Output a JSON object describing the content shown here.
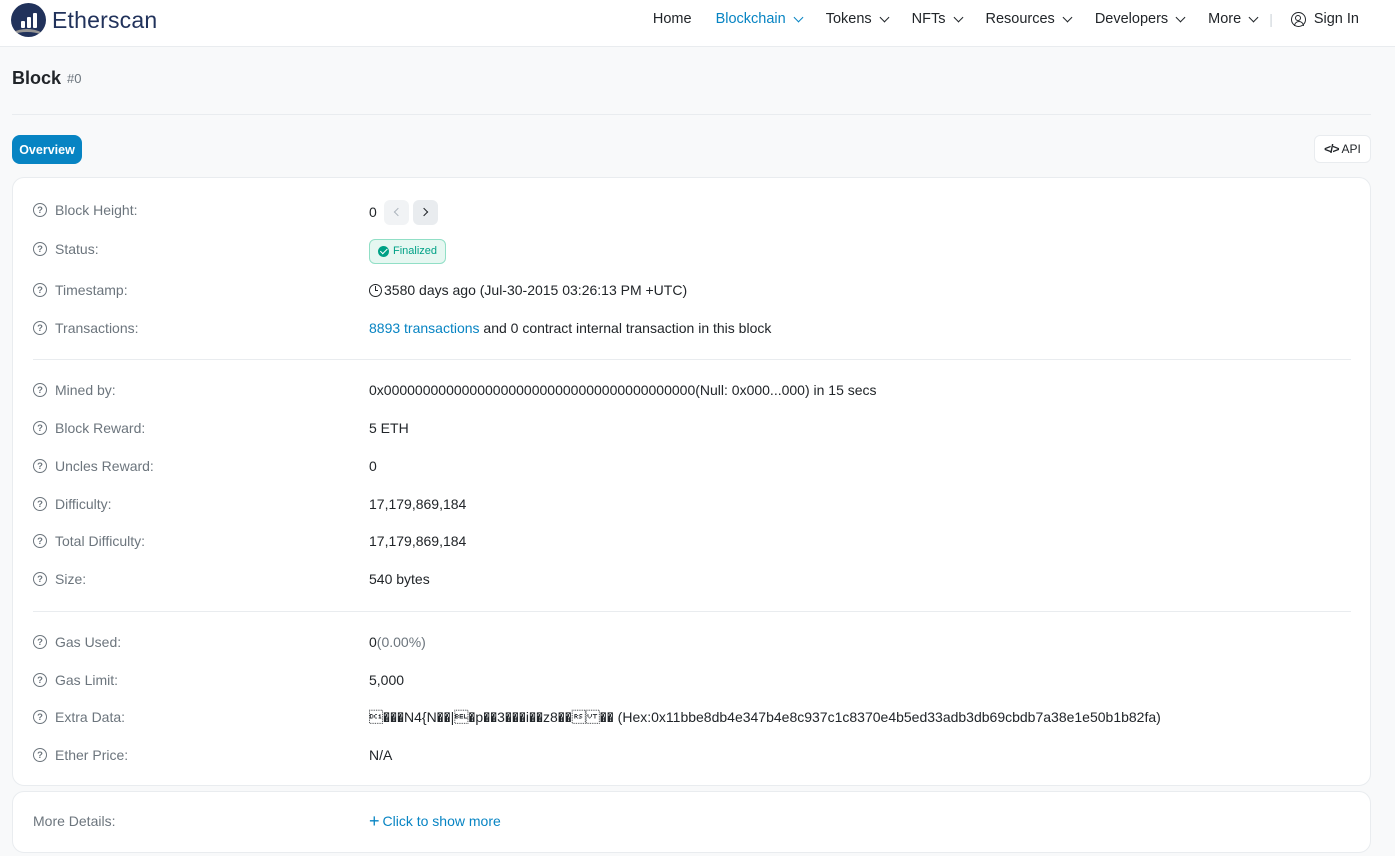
{
  "header": {
    "logo_text": "Etherscan",
    "nav": [
      {
        "label": "Home",
        "dropdown": false,
        "active": false
      },
      {
        "label": "Blockchain",
        "dropdown": true,
        "active": true
      },
      {
        "label": "Tokens",
        "dropdown": true,
        "active": false
      },
      {
        "label": "NFTs",
        "dropdown": true,
        "active": false
      },
      {
        "label": "Resources",
        "dropdown": true,
        "active": false
      },
      {
        "label": "Developers",
        "dropdown": true,
        "active": false
      },
      {
        "label": "More",
        "dropdown": true,
        "active": false
      }
    ],
    "separator": "|",
    "sign_in": "Sign In"
  },
  "page": {
    "title": "Block",
    "subtitle": "#0"
  },
  "tabs": {
    "overview": "Overview",
    "api": "API",
    "api_icon": "</>"
  },
  "overview": {
    "block_height": {
      "label": "Block Height:",
      "value": "0"
    },
    "status": {
      "label": "Status:",
      "value": "Finalized"
    },
    "timestamp": {
      "label": "Timestamp:",
      "value": "3580 days ago (Jul-30-2015 03:26:13 PM +UTC)"
    },
    "transactions": {
      "label": "Transactions:",
      "link": "8893 transactions",
      "rest": " and 0 contract internal transaction in this block"
    },
    "mined_by": {
      "label": "Mined by:",
      "value": "0x0000000000000000000000000000000000000000(Null: 0x000...000) in 15 secs"
    },
    "block_reward": {
      "label": "Block Reward:",
      "value": "5 ETH"
    },
    "uncles_reward": {
      "label": "Uncles Reward:",
      "value": "0"
    },
    "difficulty": {
      "label": "Difficulty:",
      "value": "17,179,869,184"
    },
    "total_difficulty": {
      "label": "Total Difficulty:",
      "value": "17,179,869,184"
    },
    "size": {
      "label": "Size:",
      "value": "540 bytes"
    },
    "gas_used": {
      "label": "Gas Used:",
      "value": "0",
      "pct": "(0.00%)"
    },
    "gas_limit": {
      "label": "Gas Limit:",
      "value": "5,000"
    },
    "extra_data": {
      "label": "Extra Data:",
      "value": "\u0011���N4{N��|\u0007�p��3���i��z8��\u001e\u000b�� (Hex:0x11bbe8db4e347b4e8c937c1c8370e4b5ed33adb3db69cbdb7a38e1e50b1b82fa)"
    },
    "ether_price": {
      "label": "Ether Price:",
      "value": "N/A"
    }
  },
  "more_details": {
    "label": "More Details:",
    "plus": "+",
    "link": "Click to show more"
  },
  "colors": {
    "accent": "#0784c3",
    "brand": "#21325b",
    "success": "#00a186"
  }
}
